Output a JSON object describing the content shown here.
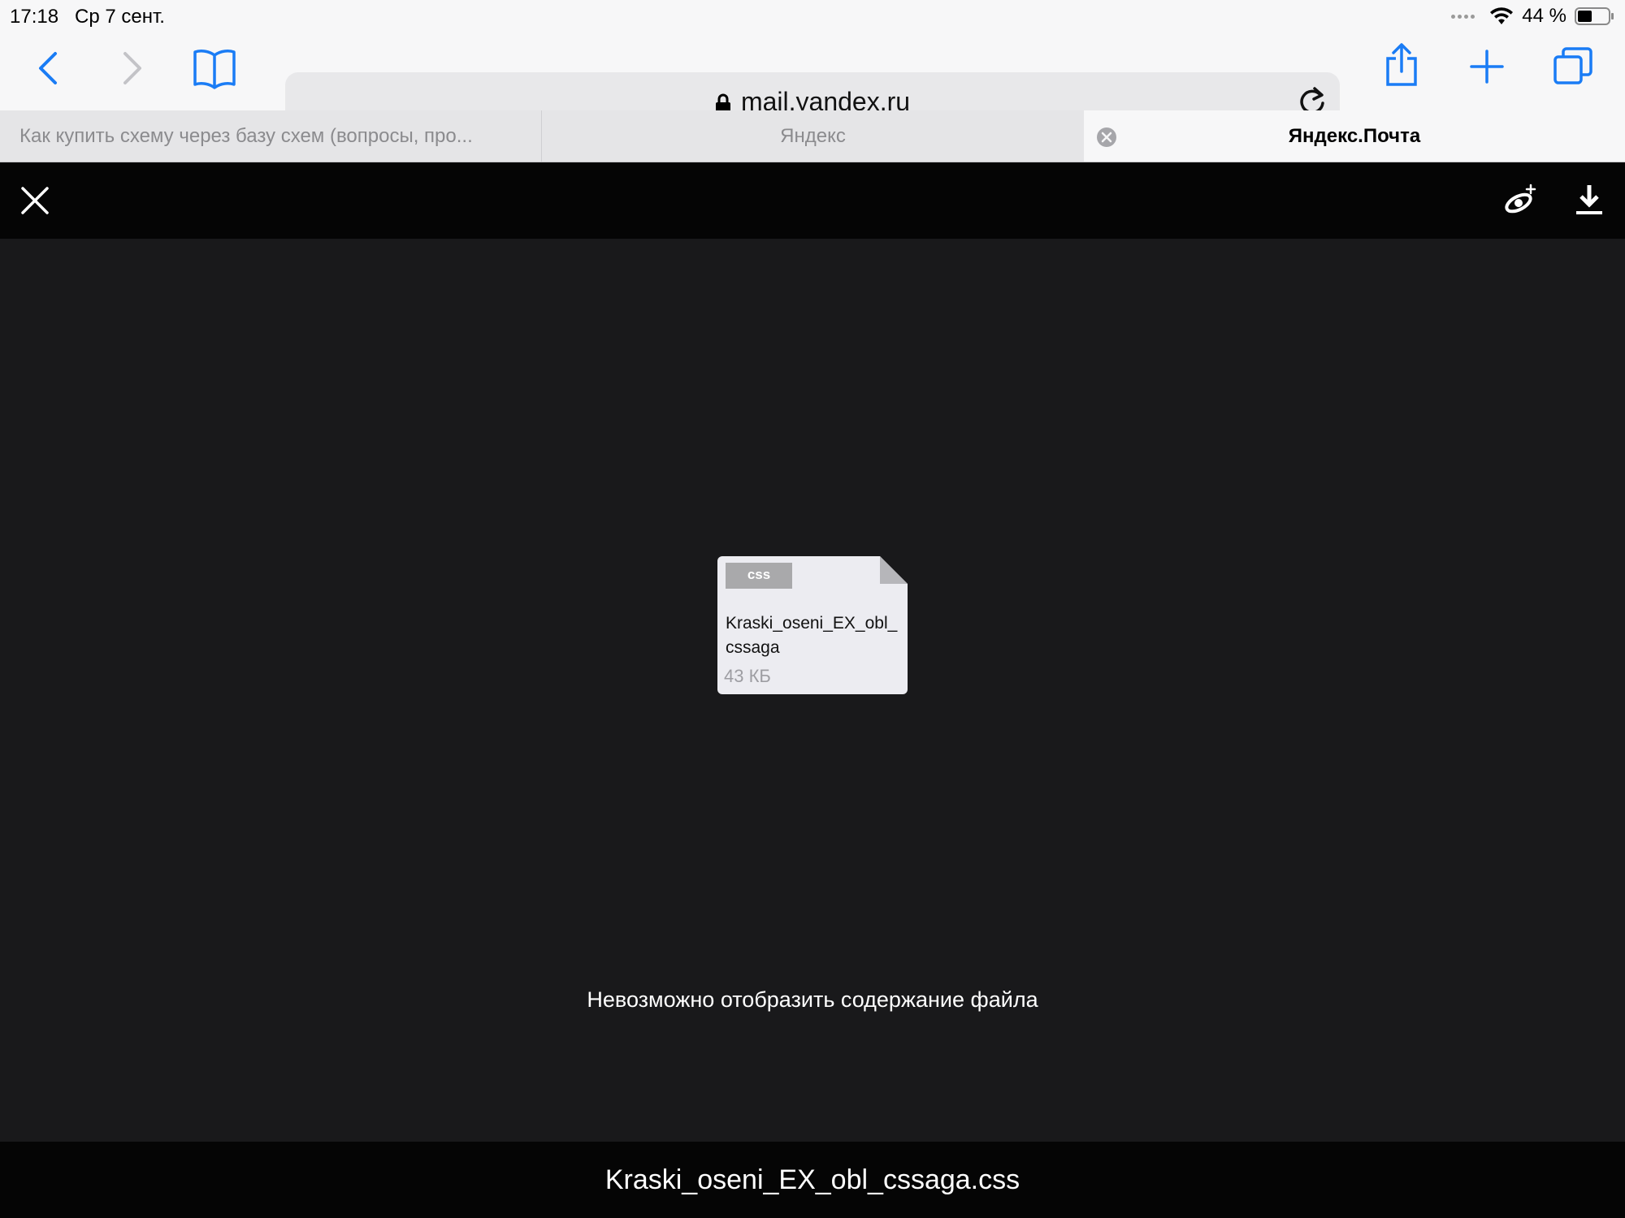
{
  "status_bar": {
    "time": "17:18",
    "date": "Ср 7 сент.",
    "battery": "44 %"
  },
  "browser": {
    "url": "mail.yandex.ru",
    "tabs": [
      {
        "label": "Как купить схему через базу схем (вопросы, про..."
      },
      {
        "label": "Яндекс"
      },
      {
        "label": "Яндекс.Почта"
      }
    ]
  },
  "viewer": {
    "file_type": "css",
    "file_name_preview": "Kraski_oseni_EX_obl_cssaga",
    "file_size": "43 КБ",
    "message": "Невозможно отобразить содержание файла",
    "footer_filename": "Kraski_oseni_EX_obl_cssaga.css"
  },
  "colors": {
    "accent": "#1a7cf5",
    "viewer_bg": "#19191b",
    "viewer_bar": "#050505"
  }
}
